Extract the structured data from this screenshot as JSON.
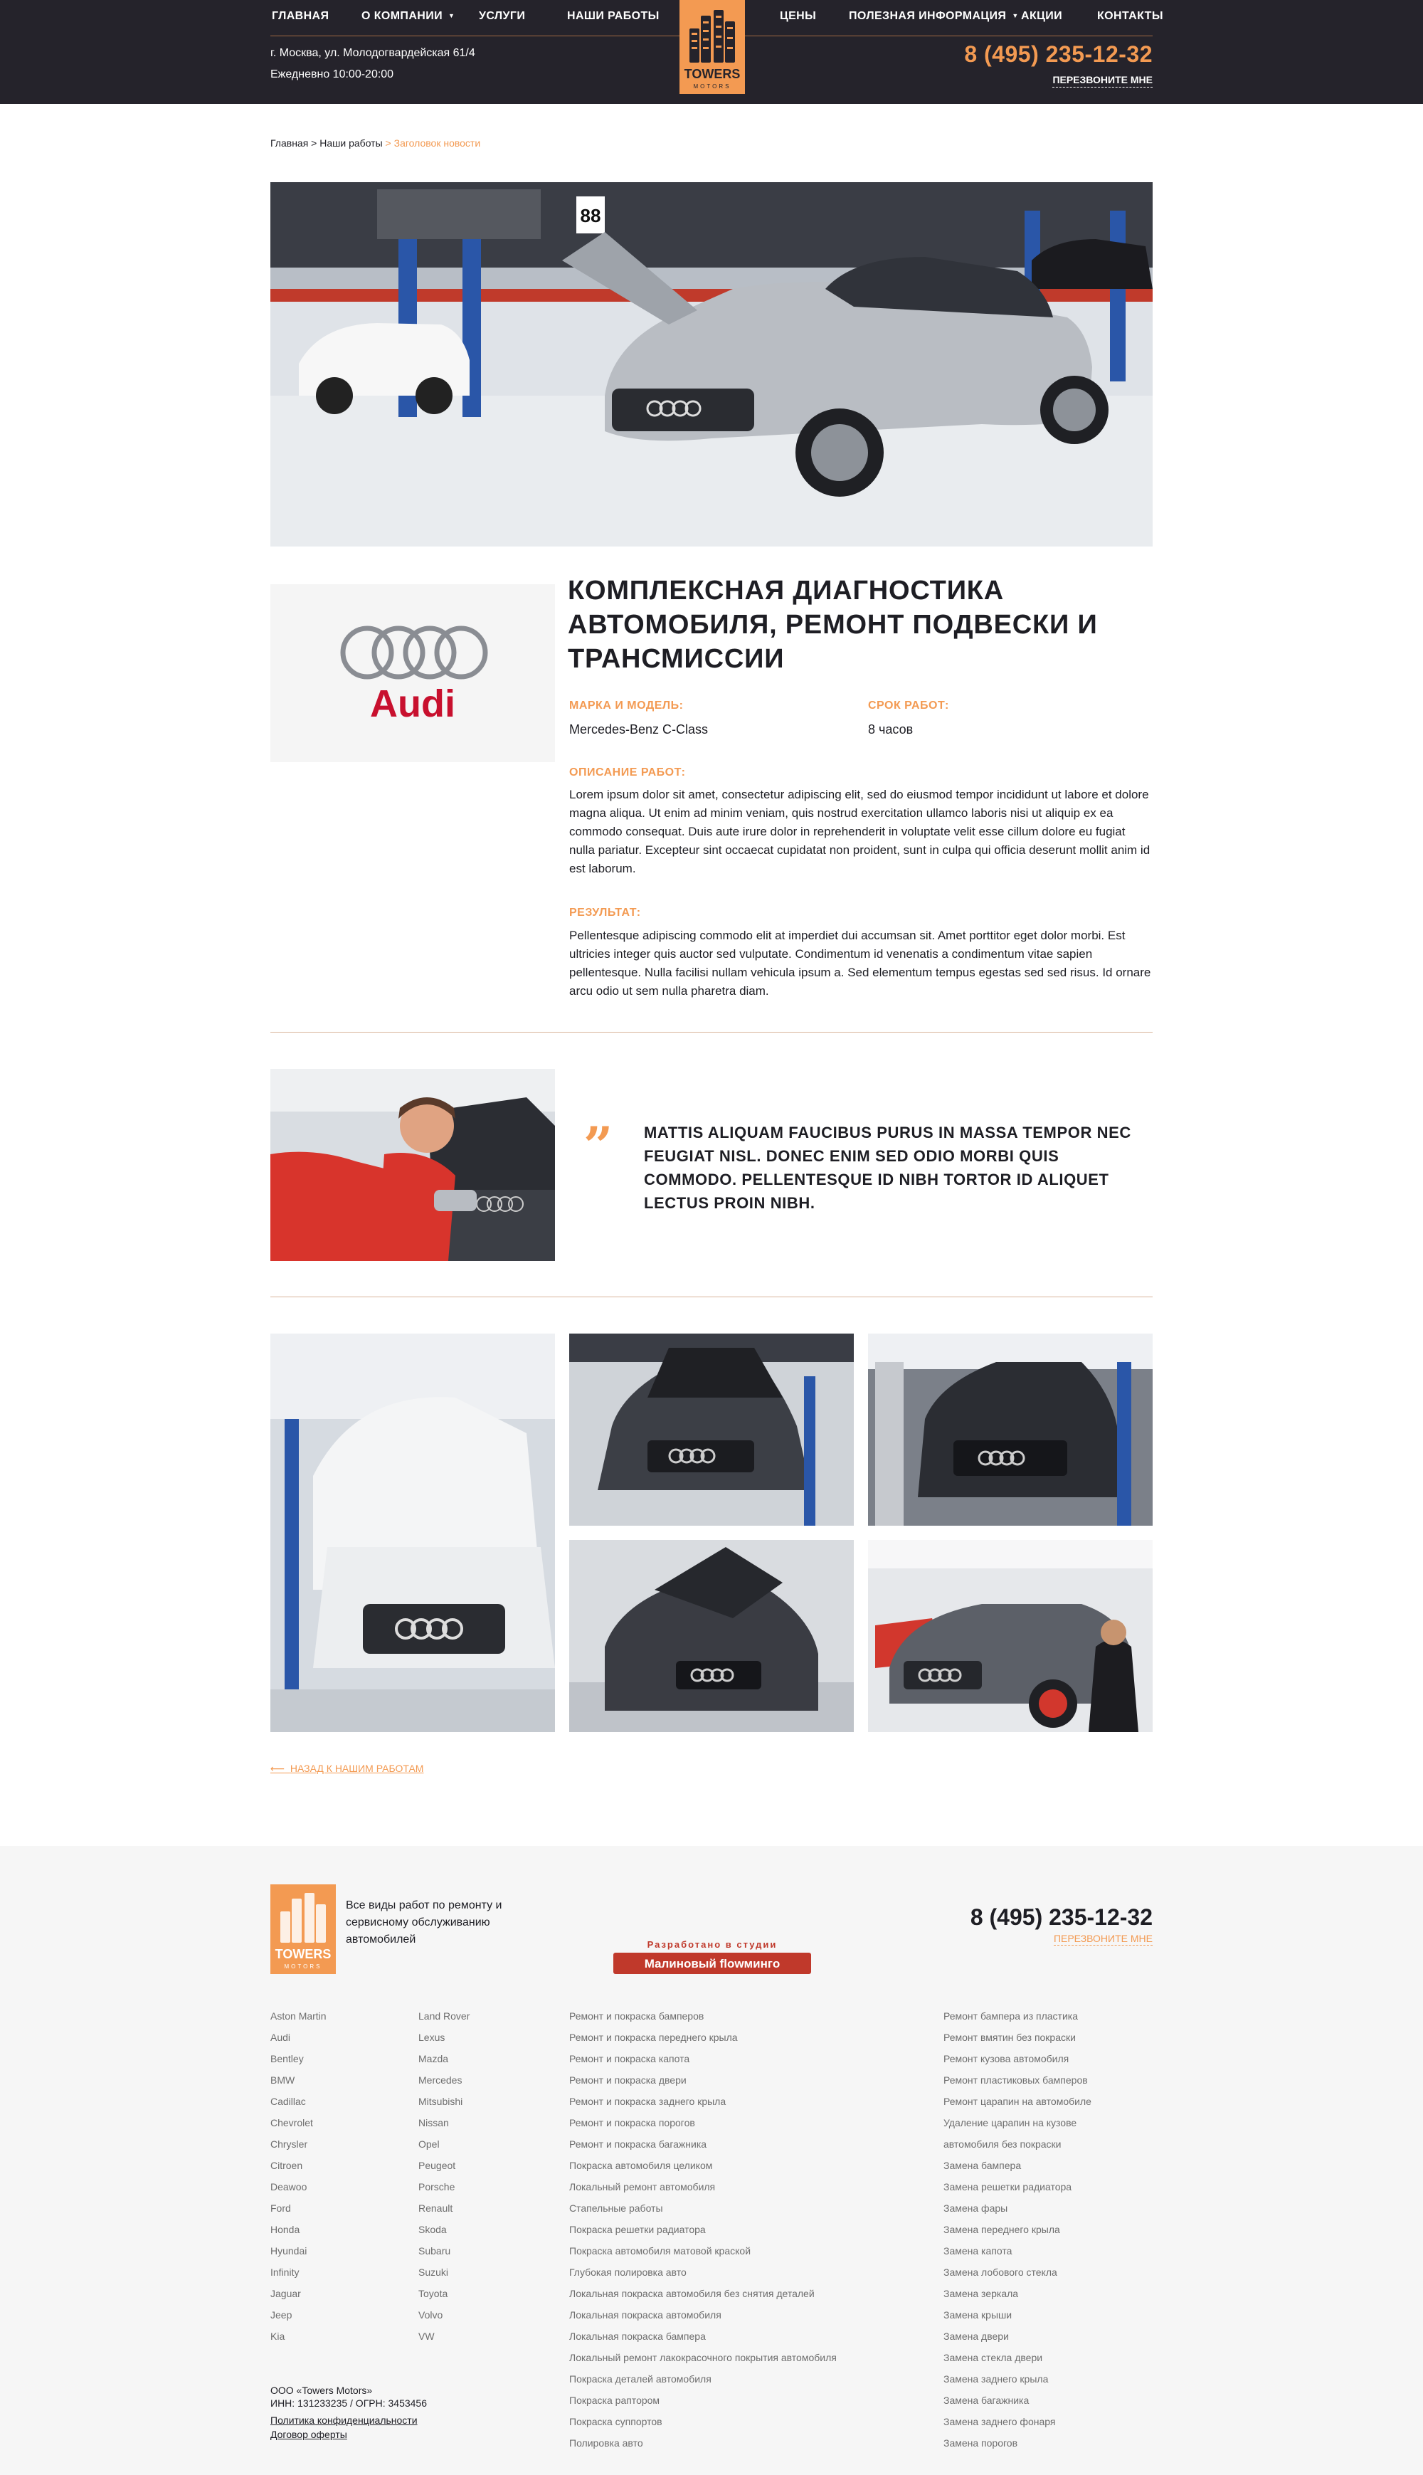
{
  "header": {
    "nav_left": [
      "Главная",
      "О компании",
      "Услуги",
      "Наши работы"
    ],
    "nav_right": [
      "Цены",
      "Полезная информация",
      "Акции",
      "Контакты"
    ],
    "logo_text": "TOWERS",
    "logo_sub": "MOTORS",
    "address": "г. Москва, ул. Молодогвардейская 61/4",
    "hours": "Ежедневно 10:00-20:00",
    "phone": "8 (495) 235-12-32",
    "callback": "Перезвоните мне"
  },
  "breadcrumb": {
    "home": "Главная",
    "sep1": " > ",
    "works": "Наши работы",
    "sep2": " > ",
    "current": "Заголовок новости"
  },
  "article": {
    "brand_logo": "Audi",
    "title": "Комплексная диагностика автомобиля, ремонт подвески и трансмиссии",
    "model_label": "Марка и модель:",
    "model_value": "Mercedes-Benz C-Class",
    "term_label": "Срок работ:",
    "term_value": "8 часов",
    "desc_label": "Описание работ:",
    "desc_text": "Lorem ipsum dolor sit amet, consectetur adipiscing elit, sed do eiusmod tempor incididunt ut labore et dolore magna aliqua. Ut enim ad minim veniam, quis nostrud exercitation ullamco laboris nisi ut aliquip ex ea commodo consequat. Duis aute irure dolor in reprehenderit in voluptate velit esse cillum dolore eu fugiat nulla pariatur. Excepteur sint occaecat cupidatat non proident, sunt in culpa qui officia deserunt mollit anim id est laborum.",
    "result_label": "Результат:",
    "result_text": "Pellentesque adipiscing commodo elit at imperdiet dui accumsan sit. Amet porttitor eget dolor morbi. Est ultricies integer quis auctor sed vulputate. Condimentum id venenatis a condimentum vitae sapien pellentesque. Nulla facilisi nullam vehicula ipsum a. Sed elementum tempus egestas sed sed risus. Id ornare arcu odio ut sem nulla pharetra diam."
  },
  "quote": {
    "mark": "”",
    "text": "Mattis aliquam faucibus purus in massa tempor nec feugiat nisl. Donec enim sed odio morbi quis commodo. Pellentesque id nibh tortor id aliquet lectus proin nibh."
  },
  "back_link": "Назад к нашим работам",
  "back_arrow": "⟵",
  "footer": {
    "desc": "Все виды работ по ремонту и сервисному обслуживанию автомобилей",
    "studio_top": "Разработано в студии",
    "studio_name": "Малиновый flowмингo",
    "phone": "8 (495) 235-12-32",
    "callback": "Перезвоните мне",
    "brands_col1": [
      "Aston Martin",
      "Audi",
      "Bentley",
      "BMW",
      "Cadillac",
      "Chevrolet",
      "Chrysler",
      "Citroen",
      "Deawoo",
      "Ford",
      "Honda",
      "Hyundai",
      "Infinity",
      "Jaguar",
      "Jeep",
      "Kia"
    ],
    "brands_col2": [
      "Land Rover",
      "Lexus",
      "Mazda",
      "Mercedes",
      "Mitsubishi",
      "Nissan",
      "Opel",
      "Peugeot",
      "Porsche",
      "Renault",
      "Skoda",
      "Subaru",
      "Suzuki",
      "Toyota",
      "Volvo",
      "VW"
    ],
    "services_col1": [
      "Ремонт и покраска бамперов",
      "Ремонт и покраска переднего крыла",
      "Ремонт и покраска капота",
      "Ремонт и покраска двери",
      "Ремонт и покраска заднего крыла",
      "Ремонт и покраска порогов",
      "Ремонт и покраска багажника",
      "Покраска автомобиля целиком",
      "Локальный ремонт автомобиля",
      "Стапельные работы",
      "Покраска решетки радиатора",
      "Покраска автомобиля матовой краской",
      "Глубокая полировка авто",
      "Локальная покраска автомобиля без снятия деталей",
      "Локальная покраска автомобиля",
      "Локальная покраска бампера",
      "Локальный ремонт лакокрасочного покрытия автомобиля",
      "Покраска деталей автомобиля",
      "Покраска раптором",
      "Покраска суппортов",
      "Полировка авто"
    ],
    "services_col2": [
      "Ремонт бампера из пластика",
      "Ремонт вмятин без покраски",
      "Ремонт кузова автомобиля",
      "Ремонт пластиковых бамперов",
      "Ремонт царапин на автомобиле",
      "Удаление царапин на кузове",
      "автомобиля без покраски",
      "Замена бампера",
      "Замена решетки радиатора",
      "Замена фары",
      "Замена переднего крыла",
      "Замена капота",
      "Замена лобового стекла",
      "Замена зеркала",
      "Замена крыши",
      "Замена двери",
      "Замена стекла двери",
      "Замена заднего крыла",
      "Замена багажника",
      "Замена заднего фонаря",
      "Замена порогов"
    ],
    "company": "ООО «Towers Motors»",
    "reg": "ИНН: 131233235 / ОГРН: 3453456",
    "privacy": "Политика конфиденциальности",
    "offer": "Договор оферты"
  },
  "colors": {
    "accent": "#f39a52",
    "dark": "#25232b",
    "audi_red": "#c8102e"
  }
}
